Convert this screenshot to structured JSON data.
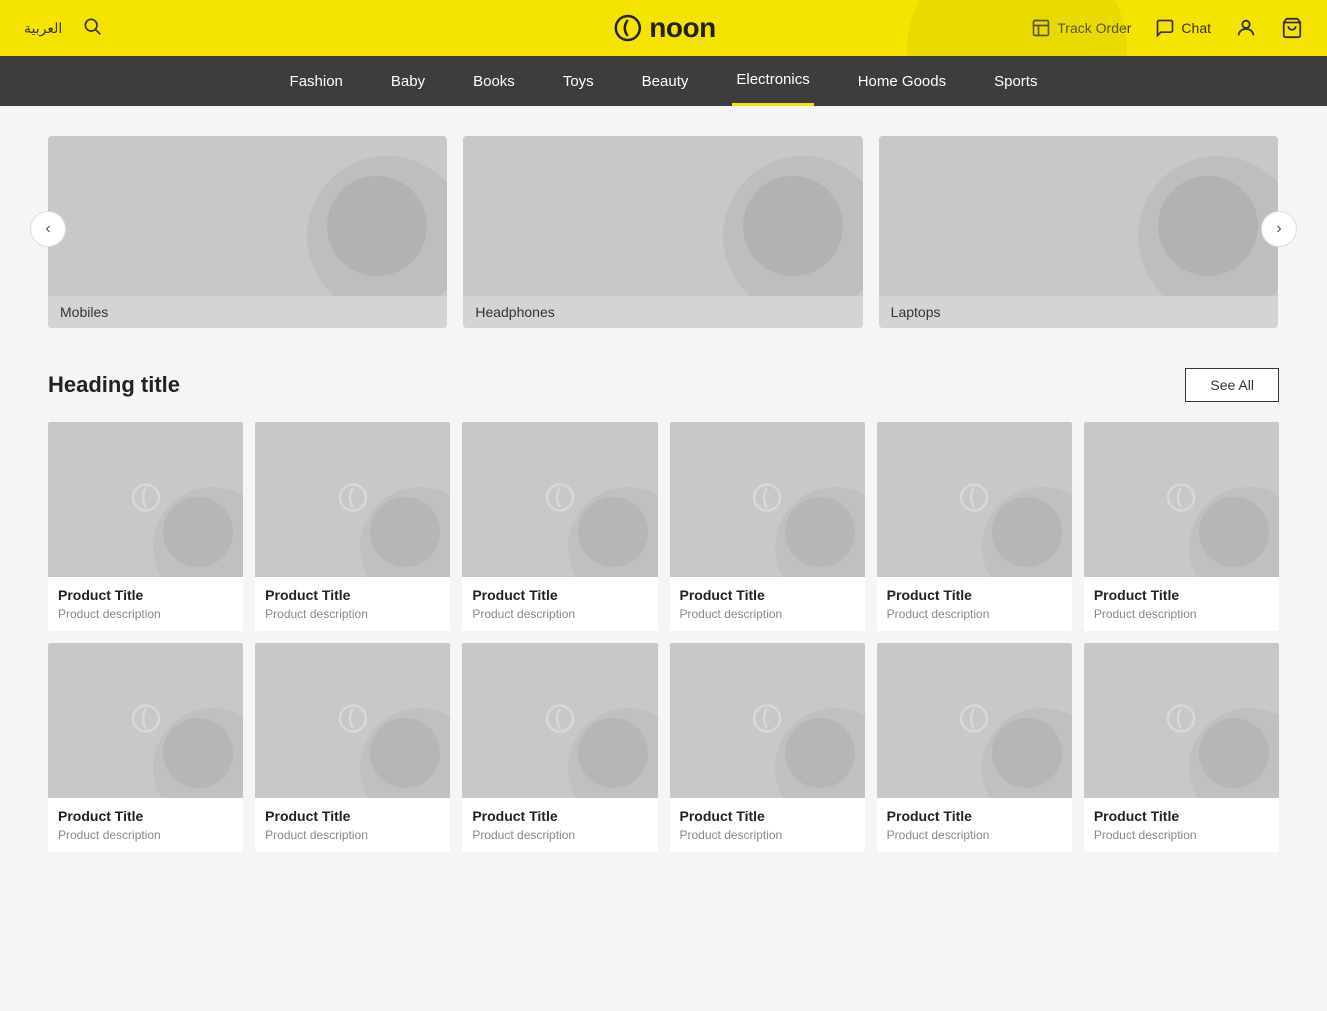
{
  "header": {
    "arabic_label": "العربية",
    "logo_text": "noon",
    "track_order_label": "Track Order",
    "chat_label": "Chat"
  },
  "nav": {
    "items": [
      {
        "label": "Fashion",
        "active": false
      },
      {
        "label": "Baby",
        "active": false
      },
      {
        "label": "Books",
        "active": false
      },
      {
        "label": "Toys",
        "active": false
      },
      {
        "label": "Beauty",
        "active": false
      },
      {
        "label": "Electronics",
        "active": true
      },
      {
        "label": "Home Goods",
        "active": false
      },
      {
        "label": "Sports",
        "active": false
      }
    ]
  },
  "carousel": {
    "prev_label": "‹",
    "next_label": "›",
    "items": [
      {
        "label": "Mobiles"
      },
      {
        "label": "Headphones"
      },
      {
        "label": "Laptops"
      }
    ]
  },
  "products_section": {
    "heading": "Heading title",
    "see_all_label": "See All",
    "products": [
      {
        "title": "Product Title",
        "description": "Product description"
      },
      {
        "title": "Product Title",
        "description": "Product description"
      },
      {
        "title": "Product Title",
        "description": "Product description"
      },
      {
        "title": "Product Title",
        "description": "Product description"
      },
      {
        "title": "Product Title",
        "description": "Product description"
      },
      {
        "title": "Product Title",
        "description": "Product description"
      },
      {
        "title": "Product Title",
        "description": "Product description"
      },
      {
        "title": "Product Title",
        "description": "Product description"
      },
      {
        "title": "Product Title",
        "description": "Product description"
      },
      {
        "title": "Product Title",
        "description": "Product description"
      },
      {
        "title": "Product Title",
        "description": "Product description"
      },
      {
        "title": "Product Title",
        "description": "Product description"
      }
    ]
  },
  "colors": {
    "accent": "#f5e400",
    "nav_bg": "#3d3d3d",
    "placeholder_bg": "#c8c8c8"
  }
}
